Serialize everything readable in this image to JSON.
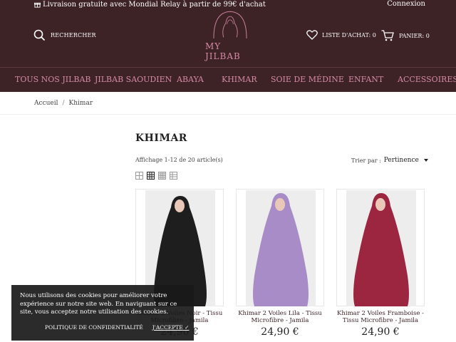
{
  "header": {
    "promo": "Livraison gratuite avec Mondial Relay à partir de 99€ d'achat",
    "login": "Connexion",
    "search_label": "RECHERCHER",
    "logo_text": "MY JILBAB",
    "wishlist_label": "LISTE D'ACHAT: 0",
    "cart_label": "PANIER: 0"
  },
  "nav": {
    "items": [
      "TOUS NOS JILBAB",
      "JILBAB SAOUDIEN",
      "ABAYA",
      "KHIMAR",
      "SOIE DE MÉDINE",
      "ENFANT",
      "ACCESSOIRES"
    ]
  },
  "breadcrumb": {
    "home": "Accueil",
    "separator": "/",
    "current": "Khimar"
  },
  "listing": {
    "title": "KHIMAR",
    "count": "Affichage 1-12 de 20 article(s)",
    "sort_label": "Trier par :",
    "sort_value": "Pertinence"
  },
  "products": [
    {
      "name": "Khimar 2 Voiles Noir - Tissu Microfibre - Jamila",
      "price": "24,90 €",
      "color": "#1e1e1e"
    },
    {
      "name": "Khimar 2 Voiles Lila - Tissu Microfibre - Jamila",
      "price": "24,90 €",
      "color": "#a78cc8"
    },
    {
      "name": "Khimar 2 Voiles Framboise - Tissu Microfibre - Jamila",
      "price": "24,90 €",
      "color": "#9c2640"
    }
  ],
  "cookie": {
    "text": "Nous utilisons des cookies pour améliorer votre expérience sur notre site web. En naviguant sur ce site, vous acceptez notre utilisation des cookies.",
    "policy": "POLITIQUE DE CONFIDENTIALITÉ",
    "accept": "J'ACCEPTE"
  },
  "colors": {
    "header_bg": "#3d2226",
    "accent_pink": "#d58aa6"
  },
  "icons": [
    "gift-icon",
    "search-icon",
    "heart-icon",
    "cart-icon",
    "grid-view-icon"
  ]
}
